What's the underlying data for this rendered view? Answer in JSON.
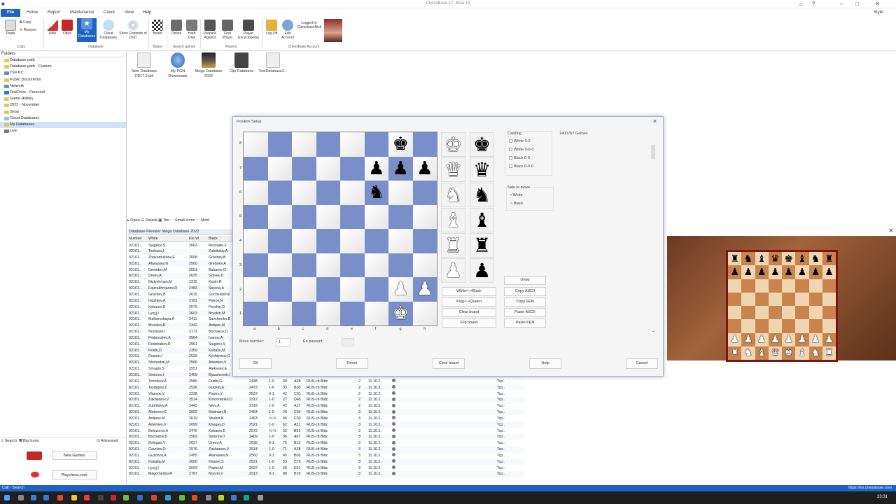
{
  "window": {
    "title": "ChessBase 17, Beta 19",
    "style_label": "Style"
  },
  "menu": {
    "file": "File",
    "items": [
      "Home",
      "Report",
      "Maintenance",
      "Cloud",
      "View",
      "Help"
    ]
  },
  "ribbon": {
    "paste": "Paste",
    "copy": "Copy",
    "remove": "Remove",
    "new": "New",
    "open": "Open",
    "my_databases": "My Databases",
    "cloud_databases": "Cloud Databases",
    "show_dvd": "Show Contents of DVD",
    "board": "Board",
    "online": "Online",
    "hard_disk": "Hard Disk",
    "prepare_against": "Prepare Against",
    "find_player": "Find Player",
    "player_encyclopedia": "Player Encyclopedia",
    "log_off": "Log Off",
    "edit_account": "Edit Account",
    "logged_in": "Logged in:",
    "username": "ChessbaseNick",
    "groups": {
      "copy": "Copy",
      "database": "Database",
      "board": "Board",
      "search": "Search games",
      "players": "Players",
      "account": "ChessBase Account"
    }
  },
  "sidebar": {
    "header": "Folders",
    "items": [
      "Database path",
      "Database path - Custom",
      "This PC",
      "Public Documents",
      "Network",
      "OneDrive - Personal",
      "Game History",
      "2022 - November",
      "Shop",
      "Cloud Databases",
      "My Databases",
      "Live"
    ],
    "selected": "My Databases",
    "search_label": "Search",
    "big_icons": "Big Icons",
    "advanced": "Advanced",
    "new_games": "New Games",
    "playchess": "Playchess.com"
  },
  "tiles": [
    {
      "label": "New Database CB17.2cbh"
    },
    {
      "label": "My PGN Downloads"
    },
    {
      "label": "Mega Database 2022"
    },
    {
      "label": "Clip Database"
    },
    {
      "label": "TestDatabase2..."
    }
  ],
  "viewbar": {
    "open": "Open",
    "details": "Details",
    "tile": "Tile",
    "small": "Small Icons",
    "medium": "Medi"
  },
  "preview": {
    "title": "Database Preview: Mega Database 2022",
    "columns": [
      "Number",
      "White",
      "Elo W",
      "Black"
    ],
    "rows": [
      [
        "92101..",
        "Sjugirov,S",
        "2663",
        "Mochalin,F"
      ],
      [
        "92101..",
        "Tsehaev,I",
        "",
        "Zubritskiy,A"
      ],
      [
        "92101..",
        "Zhakamukhov,E",
        "2008",
        "Grachev,B"
      ],
      [
        "92101..",
        "Afanasiev,N",
        "2560",
        "Grebnev,A"
      ],
      [
        "92101..",
        "Demidov,M",
        "2551",
        "Babanin,G"
      ],
      [
        "92101..",
        "Dreev,A",
        "2635",
        "Golsev,D"
      ],
      [
        "92101..",
        "Ekdyshman,M",
        "2315",
        "Kozin,R"
      ],
      [
        "92101..",
        "Faizrakhmanov,R",
        "2483",
        "Sarana,A"
      ],
      [
        "92101..",
        "Grachev,B",
        "2615",
        "Gochelashvil"
      ],
      [
        "92101..",
        "Indzhiev,A",
        "2101",
        "Petrov,N"
      ],
      [
        "92101..",
        "Kokarev,D",
        "2579",
        "Pershin,D"
      ],
      [
        "92101..",
        "Lysyj,I",
        "2603",
        "Bryakin,M"
      ],
      [
        "92101..",
        "Maltsevskaya,A",
        "2411",
        "Savchenko,B"
      ],
      [
        "92101..",
        "Musalov,R",
        "2342",
        "Antipov,M"
      ],
      [
        "92101..",
        "Nuristani,I",
        "2171",
        "Bocharov,D"
      ],
      [
        "92101..",
        "Pridorozhni,A",
        "2564",
        "Ivanov,A"
      ],
      [
        "92101..",
        "Rodshabov,R",
        "2561",
        "Sjugirov,S"
      ],
      [
        "92101..",
        "Rodin,D",
        "2359",
        "Kobalia,M"
      ],
      [
        "92101..",
        "Rozum,I",
        "2529",
        "Kyshtymov,G"
      ],
      [
        "92101..",
        "Shcherbin,M",
        "2566",
        "Artemiev,V"
      ],
      [
        "92101..",
        "Smagin,S",
        "2551",
        "Alekseev,E"
      ],
      [
        "92101..",
        "Smirnov,I",
        "2409",
        "Bjaushenok,I",
        "2514",
        "1-0",
        "37",
        "B92",
        "RUS-ch Blitz",
        "2",
        "11.10.2..",
        "Tcp.."
      ],
      [
        "92101..",
        "Timofeev,A",
        "2586",
        "Dudin,G",
        "2438",
        "1-0",
        "39",
        "A28",
        "RUS-ch Blitz",
        "2",
        "11.10.2..",
        "Tcp.."
      ],
      [
        "92101..",
        "Tsydypov,Z",
        "2526",
        "Gubsky,E",
        "2473",
        "1-0",
        "33",
        "B30",
        "RUS-ch Blitz",
        "2",
        "11.10.2..",
        "Tcp.."
      ],
      [
        "92101..",
        "Vlassov,V",
        "2238",
        "Popov,V",
        "2537",
        "0-1",
        "42",
        "C01",
        "RUS-ch Blitz",
        "2",
        "11.10.2..",
        "Tcp.."
      ],
      [
        "92101..",
        "Zakharsov,V",
        "2514",
        "Koronnenko,D",
        "2312",
        "1-0",
        "27",
        "D45",
        "RUS-ch Blitz",
        "2",
        "11.10.2..",
        "Tcp.."
      ],
      [
        "92101..",
        "Zubritskiy,A",
        "2442",
        "Ivlev,A",
        "2315",
        "1-0",
        "42",
        "A17",
        "RUS-ch Blitz",
        "2",
        "11.10.2..",
        "Tcp.."
      ],
      [
        "92101..",
        "Alekseev,E",
        "2602",
        "Matinian,N",
        "2454",
        "1-0",
        "29",
        "C54",
        "RUS-ch Blitz",
        "3",
        "11.10.2..",
        "Tcp.."
      ],
      [
        "92101..",
        "Antipov,M",
        "2619",
        "Shubin,K",
        "2463",
        "½-½",
        "46",
        "C02",
        "RUS-ch Blitz",
        "3",
        "11.10.2..",
        "Tcp.."
      ],
      [
        "92101..",
        "Artemiev,V",
        "2699",
        "Khegay,D",
        "2521",
        "1-0",
        "62",
        "A21",
        "RUS-ch Blitz",
        "3",
        "11.10.2..",
        "Tcp.."
      ],
      [
        "92101..",
        "Belozorov,A",
        "2476",
        "Kokarev,D",
        "2579",
        "½-½",
        "52",
        "B52",
        "RUS-ch Blitz",
        "3",
        "11.10.2..",
        "Tcp.."
      ],
      [
        "92101..",
        "Bocharov,D",
        "2562",
        "Smirnov,T",
        "2409",
        "1-0",
        "36",
        "A07",
        "RUS-ch Blitz",
        "3",
        "11.10.2..",
        "Tcp.."
      ],
      [
        "92101..",
        "Bologan,V",
        "2627",
        "Dreev,A",
        "2635",
        "0-1",
        "75",
        "B12",
        "RUS-ch Blitz",
        "3",
        "11.10.2..",
        "Tcp.."
      ],
      [
        "92101..",
        "Gavrilov,O",
        "2576",
        "Zakharsov,V",
        "2514",
        "1-0",
        "71",
        "A28",
        "RUS-ch Blitz",
        "3",
        "11.10.2..",
        "Tcp.."
      ],
      [
        "92101..",
        "Guzonov,A",
        "2455",
        "Afanasiev,N",
        "2560",
        "0-1",
        "45",
        "B06",
        "RUS-ch Blitz",
        "3",
        "11.10.2..",
        "Tcp.."
      ],
      [
        "92101..",
        "Kobalia,M",
        "2600",
        "Khanin,S",
        "2521",
        "1-0",
        "53",
        "C72",
        "RUS-ch Blitz",
        "3",
        "11.10.2..",
        "Tcp.."
      ],
      [
        "92101..",
        "Lysyj,I",
        "2603",
        "Popov,M",
        "2537",
        "1-0",
        "60",
        "E01",
        "RUS-ch Blitz",
        "3",
        "11.10.2..",
        "Tcp.."
      ],
      [
        "92101..",
        "Magomedov,R",
        "2767",
        "Murzin,V",
        "2513",
        "0-1",
        "88",
        "B10",
        "RUS-ch Blitz",
        "3",
        "11.10.2..",
        "Tcp.."
      ]
    ]
  },
  "dialog": {
    "title": "Position Setup",
    "files": [
      "a",
      "b",
      "c",
      "d",
      "e",
      "f",
      "g",
      "h"
    ],
    "ranks": [
      "8",
      "7",
      "6",
      "5",
      "4",
      "3",
      "2",
      "1"
    ],
    "position": [
      [
        "",
        "",
        "",
        "",
        "",
        "",
        "bK",
        ""
      ],
      [
        "",
        "",
        "",
        "",
        "",
        "bP",
        "bP",
        "bP"
      ],
      [
        "",
        "",
        "",
        "",
        "",
        "bN",
        "",
        ""
      ],
      [
        "",
        "",
        "",
        "",
        "",
        "",
        "",
        ""
      ],
      [
        "",
        "",
        "",
        "",
        "",
        "",
        "",
        ""
      ],
      [
        "",
        "",
        "",
        "",
        "",
        "",
        "",
        ""
      ],
      [
        "",
        "",
        "",
        "",
        "",
        "",
        "wP",
        "wP"
      ],
      [
        "",
        "",
        "",
        "",
        "",
        "",
        "wK",
        ""
      ]
    ],
    "buttons_left": [
      "White<->Black",
      "King<->Queen",
      "Clear board",
      "Flip board"
    ],
    "buttons_right": [
      "Undo",
      "Copy ASCII",
      "Copy FEN",
      "Paste ASCII",
      "Paste FEN"
    ],
    "castling_label": "Castling",
    "castling": [
      "White 0-0",
      "White 0-0-0",
      "Black 0-0",
      "Black 0-0-0"
    ],
    "side_label": "Side to move",
    "side_options": [
      "White",
      "Black"
    ],
    "games_count": "1400767 Games",
    "move_number_label": "Move number:",
    "move_number": "1",
    "en_passant_label": "En passant:",
    "bottom_buttons": [
      "OK",
      "Reset",
      "Clear board",
      "Help",
      "Cancel"
    ]
  },
  "status": {
    "left": "Call - Search",
    "right": "https://en.chessbase.com"
  },
  "clock": "23:31"
}
